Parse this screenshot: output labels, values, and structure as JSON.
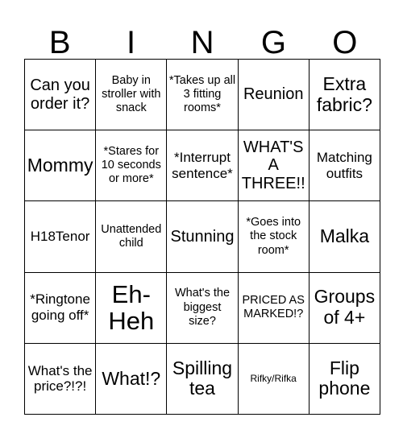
{
  "header": {
    "letters": [
      "B",
      "I",
      "N",
      "G",
      "O"
    ]
  },
  "grid": {
    "rows": 5,
    "columns": 5,
    "border_color": "#000000",
    "background_color": "#ffffff",
    "text_color": "#000000",
    "cells": [
      {
        "text": "Can you order it?",
        "size": "lg"
      },
      {
        "text": "Baby in stroller with snack",
        "size": "sm"
      },
      {
        "text": "*Takes up all 3 fitting rooms*",
        "size": "sm"
      },
      {
        "text": "Reunion",
        "size": "lg"
      },
      {
        "text": "Extra fabric?",
        "size": "xl"
      },
      {
        "text": "Mommy",
        "size": "xl"
      },
      {
        "text": "*Stares for 10 seconds or more*",
        "size": "sm"
      },
      {
        "text": "*Interrupt sentence*",
        "size": "md"
      },
      {
        "text": "WHAT'S A THREE!!",
        "size": "lg"
      },
      {
        "text": "Matching outfits",
        "size": "md"
      },
      {
        "text": "H18Tenor",
        "size": "md"
      },
      {
        "text": "Unattended child",
        "size": "sm"
      },
      {
        "text": "Stunning",
        "size": "lg"
      },
      {
        "text": "*Goes into the stock room*",
        "size": "sm"
      },
      {
        "text": "Malka",
        "size": "xl"
      },
      {
        "text": "*Ringtone going off*",
        "size": "md"
      },
      {
        "text": "Eh-Heh",
        "size": "xxl"
      },
      {
        "text": "What's the biggest size?",
        "size": "sm"
      },
      {
        "text": "PRICED AS MARKED!?",
        "size": "sm"
      },
      {
        "text": "Groups of 4+",
        "size": "xl"
      },
      {
        "text": "What's the price?!?!",
        "size": "md"
      },
      {
        "text": "What!?",
        "size": "xl"
      },
      {
        "text": "Spilling tea",
        "size": "xl"
      },
      {
        "text": "Rifky/Rifka",
        "size": "xs"
      },
      {
        "text": "Flip phone",
        "size": "xl"
      }
    ]
  }
}
